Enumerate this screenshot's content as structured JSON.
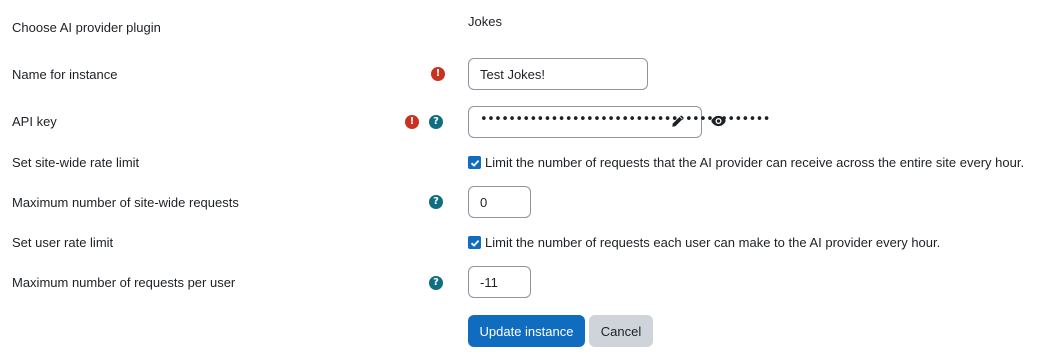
{
  "form": {
    "provider_plugin": {
      "label": "Choose AI provider plugin",
      "value": "Jokes"
    },
    "instance_name": {
      "label": "Name for instance",
      "value": "Test Jokes!",
      "required_icon": "exclamation-circle-icon"
    },
    "api_key": {
      "label": "API key",
      "masked_value": "•••••••••••••••••••••••••••••••••••••••••",
      "required_icon": "exclamation-circle-icon",
      "help_icon": "question-circle-icon",
      "edit_icon": "pencil-icon",
      "reveal_icon": "eye-icon"
    },
    "site_rate_limit": {
      "label": "Set site-wide rate limit",
      "checked": true,
      "checkbox_label": "Limit the number of requests that the AI provider can receive across the entire site every hour."
    },
    "max_site_requests": {
      "label": "Maximum number of site-wide requests",
      "value": "0",
      "help_icon": "question-circle-icon"
    },
    "user_rate_limit": {
      "label": "Set user rate limit",
      "checked": true,
      "checkbox_label": "Limit the number of requests each user can make to the AI provider every hour."
    },
    "max_user_requests": {
      "label": "Maximum number of requests per user",
      "value": "-11",
      "help_icon": "question-circle-icon"
    }
  },
  "actions": {
    "submit_label": "Update instance",
    "cancel_label": "Cancel"
  },
  "colors": {
    "primary": "#0f6cbf",
    "required": "#ca3120",
    "help": "#0f6e80",
    "secondary_button": "#ced4da"
  }
}
